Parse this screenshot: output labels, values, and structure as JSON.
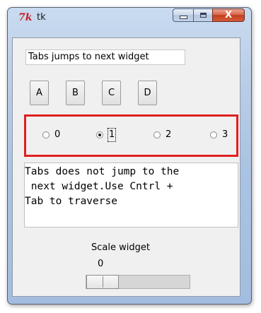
{
  "window": {
    "title": "tk",
    "icon": "tk-feather-icon",
    "controls": {
      "minimize": "minimize-icon",
      "maximize": "maximize-icon",
      "close_label": "X"
    }
  },
  "entry": {
    "value": "Tabs jumps to next widget"
  },
  "buttons": [
    "A",
    "B",
    "C",
    "D"
  ],
  "radio": {
    "options": [
      "0",
      "1",
      "2",
      "3"
    ],
    "selected": "1"
  },
  "text": {
    "content": "Tabs does not jump to the\n next widget.Use Cntrl +\nTab to traverse"
  },
  "scale": {
    "label": "Scale widget",
    "value": "0"
  },
  "colors": {
    "highlight_border": "#e02020",
    "tk_icon": "#c8202a"
  }
}
